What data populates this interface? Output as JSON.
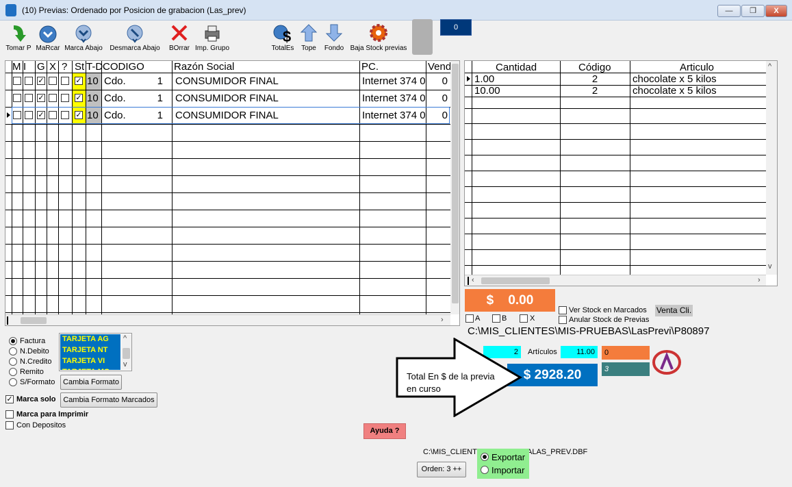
{
  "window": {
    "title": "(10) Previas: Ordenado por Posicion de grabacion (Las_prev)",
    "min": "—",
    "max": "❐",
    "close": "X"
  },
  "toolbar": [
    {
      "label": "Tomar P",
      "icon": "green-arrow-icon"
    },
    {
      "label": "MaRcar",
      "icon": "chevron-down-icon"
    },
    {
      "label": "Marca Abajo",
      "icon": "mark-down-icon"
    },
    {
      "label": "Desmarca Abajo",
      "icon": "unmark-down-icon"
    },
    {
      "label": "BOrrar",
      "icon": "red-x-icon"
    },
    {
      "label": "Imp. Grupo",
      "icon": "printer-icon"
    },
    {
      "label": "TotalEs",
      "icon": "totals-dollar-icon"
    },
    {
      "label": "Tope",
      "icon": "up-arrow-icon"
    },
    {
      "label": "Fondo",
      "icon": "down-arrow-icon"
    },
    {
      "label": "Baja Stock previas",
      "icon": "gear-icon"
    }
  ],
  "counter": "0",
  "left_grid": {
    "headers": [
      "M",
      "I",
      "G",
      "X",
      "?",
      "St",
      "T-D",
      "CODIGO",
      "Razón Social",
      "PC.",
      "Vend"
    ],
    "rows": [
      {
        "td": "10",
        "codigo": "Cdo.",
        "num": "1",
        "razon": "CONSUMIDOR FINAL",
        "pc": "Internet 374 0",
        "vend": "0",
        "g": true,
        "st": true
      },
      {
        "td": "10",
        "codigo": "Cdo.",
        "num": "1",
        "razon": "CONSUMIDOR FINAL",
        "pc": "Internet 374 0",
        "vend": "0",
        "g": true,
        "st": true
      },
      {
        "td": "10",
        "codigo": "Cdo.",
        "num": "1",
        "razon": "CONSUMIDOR FINAL",
        "pc": "Internet 374 0",
        "vend": "0",
        "g": true,
        "st": true
      }
    ]
  },
  "right_grid": {
    "headers": [
      "Cantidad",
      "Código",
      "Articulo"
    ],
    "rows": [
      {
        "cantidad": "1.00",
        "codigo": "2",
        "articulo": "chocolate x 5 kilos"
      },
      {
        "cantidad": "10.00",
        "codigo": "2",
        "articulo": "chocolate x 5 kilos"
      }
    ]
  },
  "amount_box": "$    0.00",
  "stock": {
    "ver": "Ver Stock en Marcados",
    "anular": "Anular Stock de Previas",
    "venta_cli": "Venta Cli.",
    "a": "A",
    "b": "B",
    "x": "X"
  },
  "path": "C:\\MIS_CLIENTES\\MIS-PRUEBAS\\LasPrevi\\P80897",
  "totals": {
    "count": "2",
    "articulos_label": "Artículos",
    "articulos": "11.00",
    "orange": "0",
    "teal": "3",
    "total": "$ 2928.20"
  },
  "callout": "Total En $ de la previa en curso",
  "formats": {
    "options": [
      "Factura",
      "N.Debito",
      "N.Credito",
      "Remito",
      "S/Formato"
    ],
    "selected": 0,
    "cards": [
      "TARJETA AG",
      "TARJETA NT",
      "TARJETA VI",
      "TARJETA MC"
    ],
    "cambia": "Cambia Formato",
    "cambia_marcados": "Cambia Formato Marcados",
    "marca_solo": "Marca solo",
    "marca_imprimir": "Marca para Imprimir",
    "con_depositos": "Con Depositos"
  },
  "ayuda": "Ayuda ?",
  "dbf_path": "C:\\MIS_CLIENTES\\MIS-PRUEBAS\\LasPrevi\\LAS_PREV.DBF",
  "dbf_left": "C:\\MIS_CLIENTE",
  "dbf_right": "ALAS_PREV.DBF",
  "orden": "Orden: 3 ++",
  "export": {
    "exportar": "Exportar",
    "importar": "Importar"
  },
  "colors": {
    "accent_blue": "#0070c0",
    "orange": "#f47c3c",
    "teal": "#3b7f7f",
    "yellow": "#ffff00",
    "green": "#90ee90",
    "pink": "#f08080",
    "cyan": "#00ffff"
  }
}
